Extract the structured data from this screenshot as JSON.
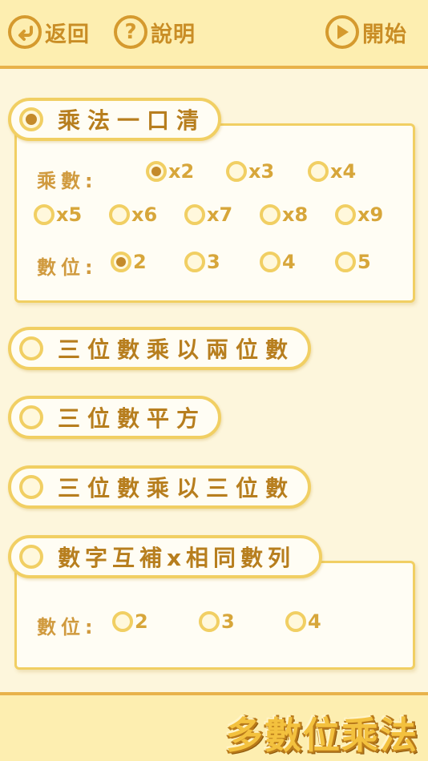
{
  "topbar": {
    "back_label": "返回",
    "help_label": "說明",
    "start_label": "開始"
  },
  "sections": {
    "s1": {
      "title": "乘法一口清",
      "multiplier_label": "乘數:",
      "multipliers": [
        "x2",
        "x3",
        "x4",
        "x5",
        "x6",
        "x7",
        "x8",
        "x9"
      ],
      "selected_multiplier": "x2",
      "digits_label": "數位:",
      "digits": [
        "2",
        "3",
        "4",
        "5"
      ],
      "selected_digits": "2"
    },
    "s2": {
      "title": "三位數乘以兩位數"
    },
    "s3": {
      "title": "三位數平方"
    },
    "s4": {
      "title": "三位數乘以三位數"
    },
    "s5": {
      "title": "數字互補x相同數列",
      "digits_label": "數位:",
      "digits": [
        "2",
        "3",
        "4"
      ]
    }
  },
  "selected_mode": "乘法一口清",
  "brand": "多數位乘法",
  "colors": {
    "accent": "#c48a2a",
    "frame": "#f1cf63",
    "bar": "#fdeeb0"
  }
}
